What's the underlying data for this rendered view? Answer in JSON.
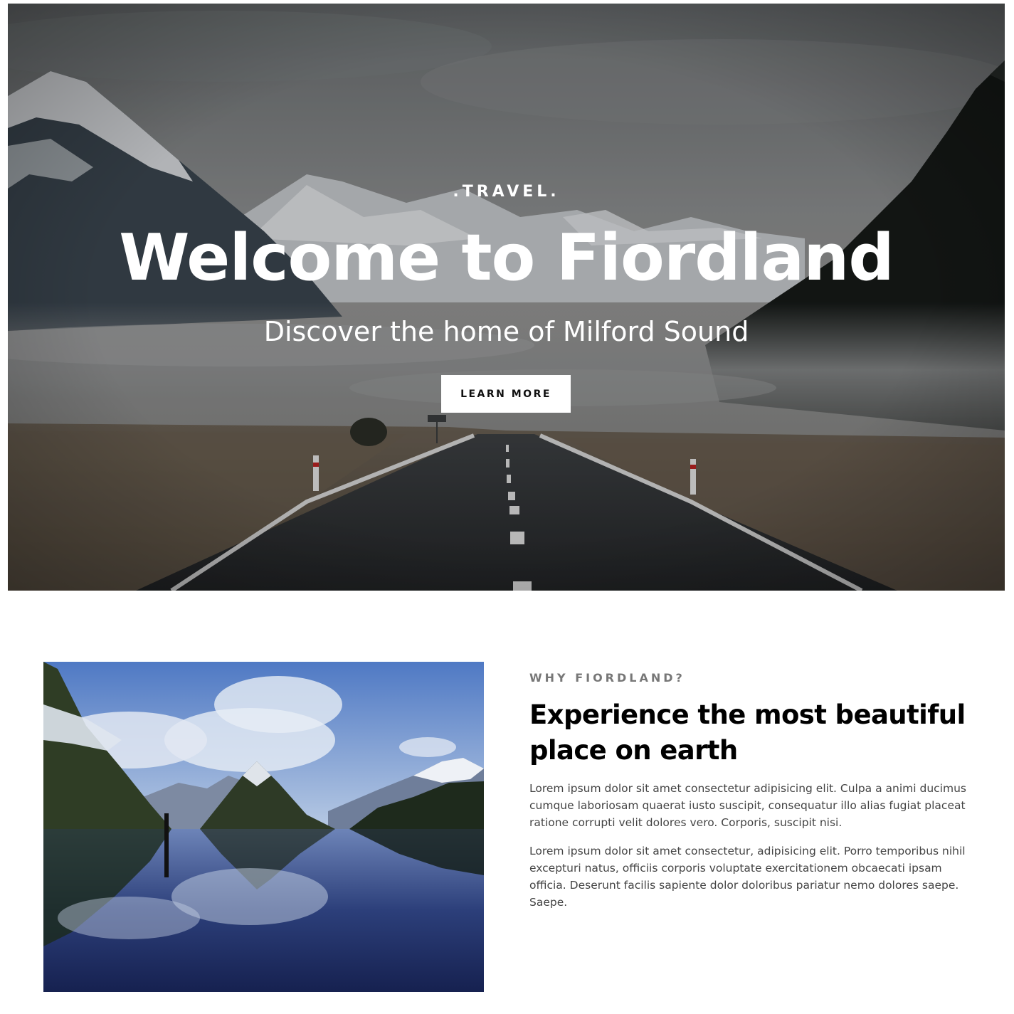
{
  "hero": {
    "kicker": ".TRAVEL.",
    "title": "Welcome to Fiordland",
    "subtitle": "Discover the home of Milford Sound",
    "button_label": "LEARN MORE"
  },
  "about": {
    "eyebrow": "WHY FIORDLAND?",
    "heading": "Experience the most beautiful place on earth",
    "paragraphs": [
      "Lorem ipsum dolor sit amet consectetur adipisicing elit. Culpa a animi ducimus cumque laboriosam quaerat iusto suscipit, consequatur illo alias fugiat placeat ratione corrupti velit dolores vero. Corporis, suscipit nisi.",
      "Lorem ipsum dolor sit amet consectetur, adipisicing elit. Porro temporibus nihil excepturi natus, officiis corporis voluptate exercitationem obcaecati ipsam officia. Deserunt facilis sapiente dolor doloribus pariatur nemo dolores saepe. Saepe."
    ]
  },
  "colors": {
    "button_bg": "#ffffff",
    "heading": "#000000",
    "eyebrow": "#777777",
    "body_text": "#444444"
  }
}
